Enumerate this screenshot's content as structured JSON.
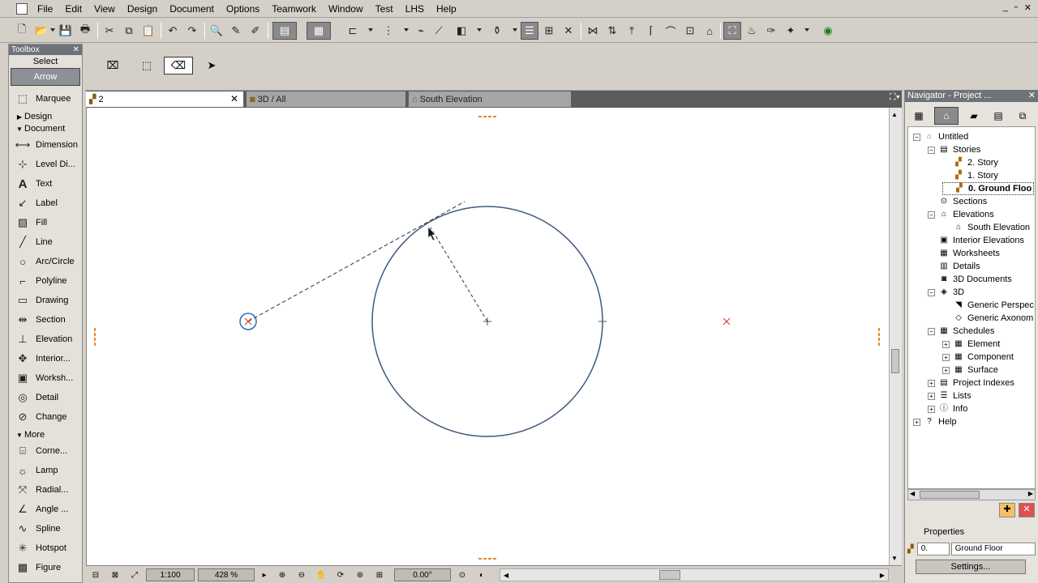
{
  "menubar": {
    "items": [
      "File",
      "Edit",
      "View",
      "Design",
      "Document",
      "Options",
      "Teamwork",
      "Window",
      "Test",
      "LHS",
      "Help"
    ],
    "minimize": "_",
    "restore": "▫",
    "close": "✕"
  },
  "toolbox": {
    "title": "Toolbox",
    "select_label": "Select",
    "arrow_label": "Arrow",
    "marquee": "Marquee",
    "design_section": "Design",
    "document_section": "Document",
    "document_tools": [
      "Dimension",
      "Level Di...",
      "Text",
      "Label",
      "Fill",
      "Line",
      "Arc/Circle",
      "Polyline",
      "Drawing",
      "Section",
      "Elevation",
      "Interior...",
      "Worksh...",
      "Detail",
      "Change"
    ],
    "more_section": "More",
    "more_tools": [
      "Corne...",
      "Lamp",
      "Radial...",
      "Angle ...",
      "Spline",
      "Hotspot",
      "Figure"
    ]
  },
  "tabs": [
    {
      "label": "2",
      "icon": "floorplan-icon",
      "active": true
    },
    {
      "label": "3D / All",
      "icon": "camera-icon",
      "active": false
    },
    {
      "label": "South Elevation",
      "icon": "elevation-icon",
      "active": false
    }
  ],
  "statusbar": {
    "scale": "1:100",
    "zoom": "428 %",
    "angle": "0.00°"
  },
  "navigator": {
    "title": "Navigator - Project ...",
    "tree": [
      {
        "label": "Untitled",
        "level": 0,
        "exp": "−",
        "icon": "house-icon"
      },
      {
        "label": "Stories",
        "level": 1,
        "exp": "−",
        "icon": "stories-icon"
      },
      {
        "label": "2. Story",
        "level": 2,
        "exp": "",
        "icon": "story-icon"
      },
      {
        "label": "1. Story",
        "level": 2,
        "exp": "",
        "icon": "story-icon"
      },
      {
        "label": "0. Ground Floo",
        "level": 2,
        "exp": "",
        "icon": "story-icon",
        "bold": true
      },
      {
        "label": "Sections",
        "level": 1,
        "exp": "",
        "icon": "section-icon"
      },
      {
        "label": "Elevations",
        "level": 1,
        "exp": "−",
        "icon": "elevation-icon"
      },
      {
        "label": "South Elevation",
        "level": 2,
        "exp": "",
        "icon": "elevation-icon"
      },
      {
        "label": "Interior Elevations",
        "level": 1,
        "exp": "",
        "icon": "interior-icon"
      },
      {
        "label": "Worksheets",
        "level": 1,
        "exp": "",
        "icon": "worksheet-icon"
      },
      {
        "label": "Details",
        "level": 1,
        "exp": "",
        "icon": "detail-icon"
      },
      {
        "label": "3D Documents",
        "level": 1,
        "exp": "",
        "icon": "3d-doc-icon"
      },
      {
        "label": "3D",
        "level": 1,
        "exp": "−",
        "icon": "3d-icon"
      },
      {
        "label": "Generic Perspec",
        "level": 2,
        "exp": "",
        "icon": "perspective-icon"
      },
      {
        "label": "Generic Axonom",
        "level": 2,
        "exp": "",
        "icon": "axonometry-icon"
      },
      {
        "label": "Schedules",
        "level": 1,
        "exp": "−",
        "icon": "schedule-icon"
      },
      {
        "label": "Element",
        "level": 2,
        "exp": "+",
        "icon": "schedule-icon"
      },
      {
        "label": "Component",
        "level": 2,
        "exp": "+",
        "icon": "schedule-icon"
      },
      {
        "label": "Surface",
        "level": 2,
        "exp": "+",
        "icon": "schedule-icon"
      },
      {
        "label": "Project Indexes",
        "level": 1,
        "exp": "+",
        "icon": "index-icon"
      },
      {
        "label": "Lists",
        "level": 1,
        "exp": "+",
        "icon": "list-icon"
      },
      {
        "label": "Info",
        "level": 1,
        "exp": "+",
        "icon": "info-icon"
      },
      {
        "label": "Help",
        "level": 0,
        "exp": "+",
        "icon": "help-icon"
      }
    ],
    "properties_label": "Properties",
    "prop_index": "0.",
    "prop_name": "Ground Floor",
    "settings_label": "Settings..."
  }
}
